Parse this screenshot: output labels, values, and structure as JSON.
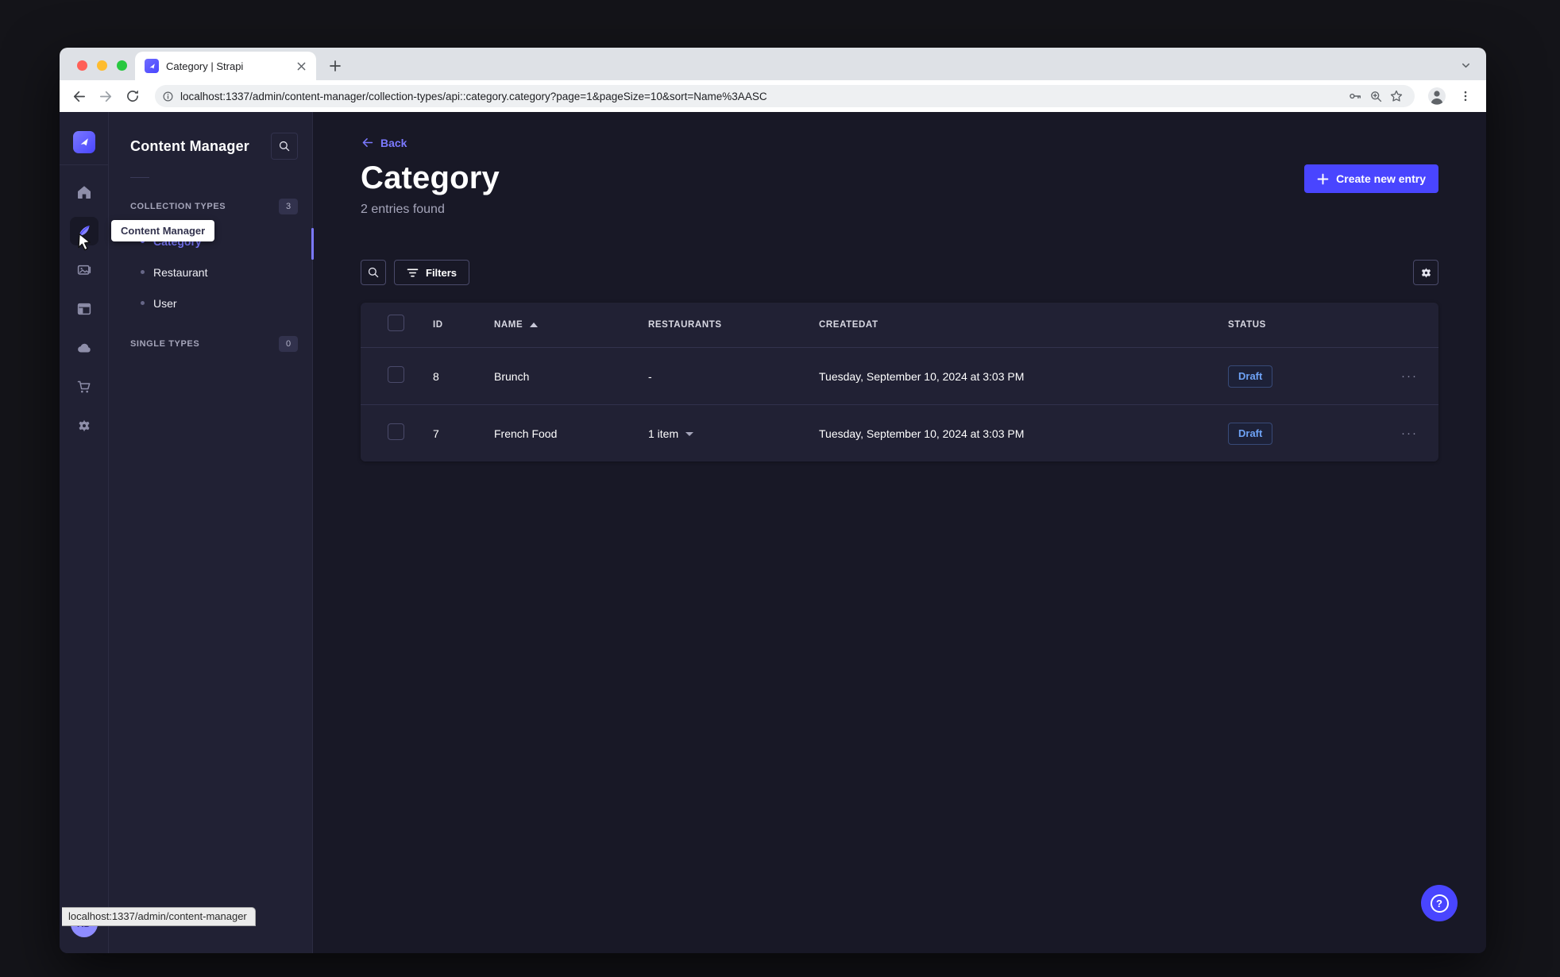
{
  "browser": {
    "tab_title": "Category | Strapi",
    "url": "localhost:1337/admin/content-manager/collection-types/api::category.category?page=1&pageSize=10&sort=Name%3AASC",
    "status_bar": "localhost:1337/admin/content-manager"
  },
  "rail": {
    "icons": [
      "strapi-logo",
      "home",
      "content-manager",
      "media-library",
      "content-type-builder",
      "cloud",
      "marketplace",
      "settings"
    ],
    "active_icon": "content-manager"
  },
  "subnav": {
    "title": "Content Manager",
    "collection_types_label": "COLLECTION TYPES",
    "collection_types_count": "3",
    "items": [
      {
        "label": "Category",
        "active": true
      },
      {
        "label": "Restaurant",
        "active": false
      },
      {
        "label": "User",
        "active": false
      }
    ],
    "single_types_label": "SINGLE TYPES",
    "single_types_count": "0"
  },
  "tooltip": {
    "label": "Content Manager"
  },
  "main": {
    "back_label": "Back",
    "title": "Category",
    "entries_found": "2 entries found",
    "create_button_label": "Create new entry",
    "filters_label": "Filters",
    "table": {
      "headers": {
        "id": "ID",
        "name": "NAME",
        "restaurants": "RESTAURANTS",
        "createdat": "CREATEDAT",
        "status": "STATUS"
      },
      "sort": {
        "column": "NAME",
        "direction": "asc"
      },
      "rows": [
        {
          "id": "8",
          "name": "Brunch",
          "restaurants": "-",
          "has_caret": false,
          "createdat": "Tuesday, September 10, 2024 at 3:03 PM",
          "status": "Draft",
          "more": "···"
        },
        {
          "id": "7",
          "name": "French Food",
          "restaurants": "1 item",
          "has_caret": true,
          "createdat": "Tuesday, September 10, 2024 at 3:03 PM",
          "status": "Draft",
          "more": "···"
        }
      ]
    }
  },
  "user": {
    "initials": "KD"
  },
  "ui": {
    "help_glyph": "?"
  },
  "colors": {
    "accent": "#4945ff",
    "accent_light": "#7b79ff",
    "app_bg": "#181826",
    "panel_bg": "#212134",
    "border": "#32324d",
    "muted_text": "#a5a5ba",
    "draft_text": "#6ea2f5",
    "traffic_lights": [
      "#ff5f57",
      "#febc2e",
      "#28c840"
    ]
  }
}
